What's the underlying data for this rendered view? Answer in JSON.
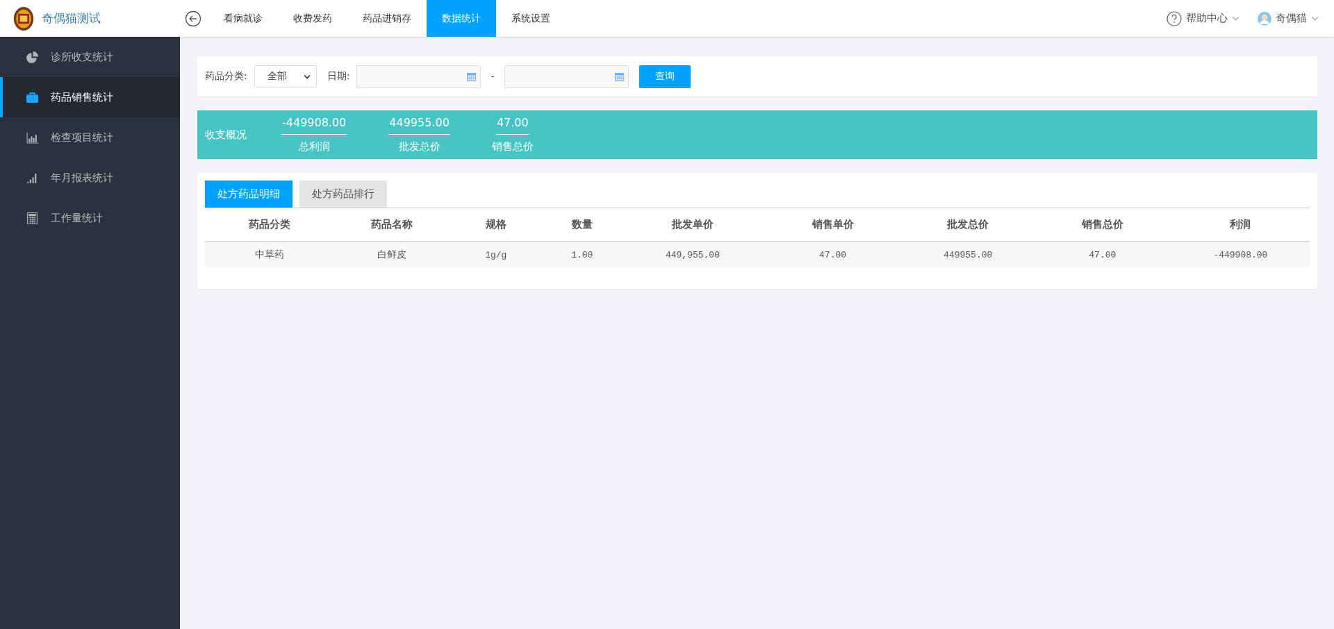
{
  "brand": {
    "title": "奇偶猫测试"
  },
  "nav": [
    {
      "label": "看病就诊",
      "selected": false
    },
    {
      "label": "收费发药",
      "selected": false
    },
    {
      "label": "药品进销存",
      "selected": false
    },
    {
      "label": "数据统计",
      "selected": true
    },
    {
      "label": "系统设置",
      "selected": false
    }
  ],
  "header_right": {
    "help": "帮助中心",
    "user": "奇偶猫"
  },
  "sidebar": {
    "items": [
      {
        "label": "诊所收支统计",
        "selected": false
      },
      {
        "label": "药品销售统计",
        "selected": true
      },
      {
        "label": "检查项目统计",
        "selected": false
      },
      {
        "label": "年月报表统计",
        "selected": false
      },
      {
        "label": "工作量统计",
        "selected": false
      }
    ]
  },
  "filter": {
    "category_label": "药品分类:",
    "category_value": "全部",
    "date_label": "日期:",
    "date_separator": "-",
    "query_button": "查询"
  },
  "summary": {
    "title": "收支概况",
    "items": [
      {
        "value": "-449908.00",
        "label": "总利润"
      },
      {
        "value": "449955.00",
        "label": "批发总价"
      },
      {
        "value": "47.00",
        "label": "销售总价"
      }
    ]
  },
  "tabs": [
    {
      "label": "处方药品明细",
      "selected": true
    },
    {
      "label": "处方药品排行",
      "selected": false
    }
  ],
  "table": {
    "columns": [
      "药品分类",
      "药品名称",
      "规格",
      "数量",
      "批发单价",
      "销售单价",
      "批发总价",
      "销售总价",
      "利润"
    ],
    "rows": [
      [
        "中草药",
        "白鲜皮",
        "1g/g",
        "1.00",
        "449,955.00",
        "47.00",
        "449955.00",
        "47.00",
        "-449908.00"
      ]
    ]
  }
}
